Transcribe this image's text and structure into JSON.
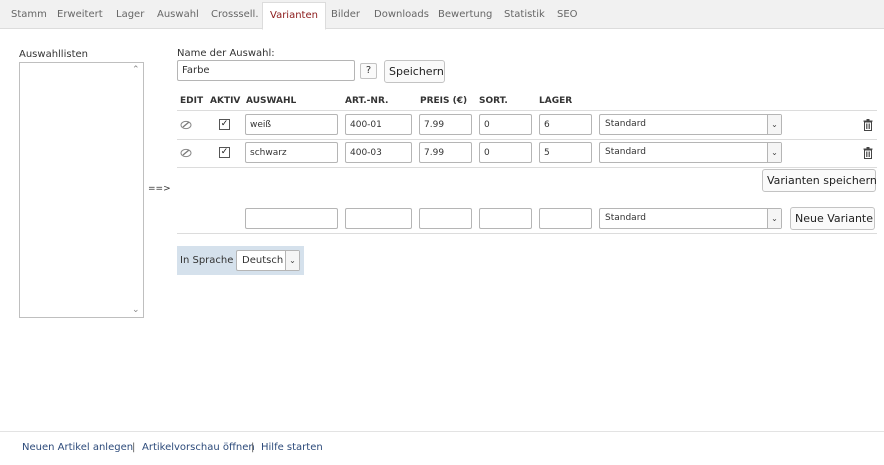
{
  "tabs": [
    {
      "label": "Stamm"
    },
    {
      "label": "Erweitert"
    },
    {
      "label": "Lager"
    },
    {
      "label": "Auswahl"
    },
    {
      "label": "Crosssell."
    },
    {
      "label": "Varianten",
      "active": true
    },
    {
      "label": "Bilder"
    },
    {
      "label": "Downloads"
    },
    {
      "label": "Bewertung"
    },
    {
      "label": "Statistik"
    },
    {
      "label": "SEO"
    }
  ],
  "sidebar": {
    "title": "Auswahllisten",
    "arrow_label": "==>"
  },
  "selection": {
    "name_label": "Name der Auswahl:",
    "name_value": "Farbe",
    "help_label": "?",
    "save_label": "Speichern"
  },
  "table": {
    "headers": [
      "EDIT",
      "AKTIV",
      "AUSWAHL",
      "ART.-NR.",
      "PREIS (€)",
      "SORT.",
      "LAGER"
    ],
    "rows": [
      {
        "auswahl": "weiß",
        "artnr": "400-01",
        "preis": "7.99",
        "sort": "0",
        "lager": "6",
        "option": "Standard",
        "aktiv": true
      },
      {
        "auswahl": "schwarz",
        "artnr": "400-03",
        "preis": "7.99",
        "sort": "0",
        "lager": "5",
        "option": "Standard",
        "aktiv": true
      }
    ],
    "save_variants_label": "Varianten speichern"
  },
  "new_variant": {
    "auswahl": "",
    "artnr": "",
    "preis": "",
    "sort": "",
    "lager": "",
    "option": "Standard",
    "button_label": "Neue Variante"
  },
  "language": {
    "label": "In Sprache",
    "value": "Deutsch"
  },
  "footer": {
    "links": [
      "Neuen Artikel anlegen",
      "Artikelvorschau öffnen",
      "Hilfe starten"
    ],
    "separator": "|"
  },
  "icons": {
    "edit": "edit-pencil-icon",
    "delete": "trash-icon",
    "select_arrow": "chevron-down-icon",
    "scroll_up": "chevron-up-icon",
    "scroll_down": "chevron-down-icon"
  },
  "colors": {
    "active_tab": "#8b1a1a",
    "tab_bar": "#f1f1f1",
    "language_box": "#d5e1ec",
    "footer_link": "#2c4a7a"
  }
}
